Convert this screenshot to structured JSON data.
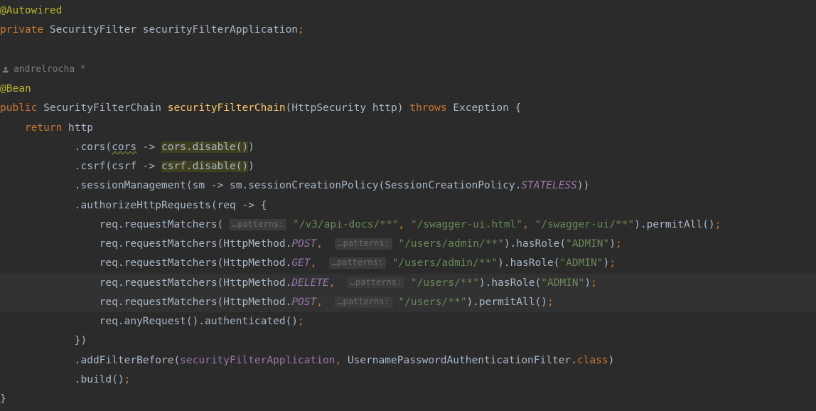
{
  "author": {
    "name": "andrelrocha *"
  },
  "l1": {
    "anno": "@Autowired"
  },
  "l2": {
    "kw": "private ",
    "type": "SecurityFilter ",
    "field": "securityFilterApplication",
    "semi": ";"
  },
  "l4": {
    "anno": "@Bean"
  },
  "l5": {
    "kw1": "public ",
    "type1": "SecurityFilterChain ",
    "mname": "securityFilterChain",
    "open": "(",
    "ptype": "HttpSecurity ",
    "pname": "http",
    "close": ") ",
    "kw2": "throws ",
    "exc": "Exception ",
    "brace": "{"
  },
  "l6": {
    "kw": "return ",
    "expr": "http"
  },
  "l7": {
    "pre": ".cors(",
    "p": "cors",
    "arrow": " -> ",
    "warn": "cors.disable()",
    "post": ")"
  },
  "l8": {
    "pre": ".csrf(csrf -> ",
    "warn": "csrf.disable()",
    "post": ")"
  },
  "l9": {
    "pre": ".sessionManagement(sm -> sm.sessionCreationPolicy(SessionCreationPolicy.",
    "const": "STATELESS",
    "post": "))"
  },
  "l10": {
    "txt": ".authorizeHttpRequests(req -> {"
  },
  "hint": "…patterns:",
  "l11": {
    "a": "req.requestMatchers( ",
    "s1": "\"/v3/api-docs/**\"",
    "c1": ", ",
    "s2": "\"/swagger-ui.html\"",
    "c2": ", ",
    "s3": "\"/swagger-ui/**\"",
    "tail": ").permitAll()",
    "semi": ";"
  },
  "l12": {
    "a": "req.requestMatchers(HttpMethod.",
    "m": "POST",
    "c": ", ",
    "s": "\"/users/admin/**\"",
    "tail": ").hasRole(",
    "role": "\"ADMIN\"",
    "close": ")",
    "semi": ";"
  },
  "l13": {
    "a": "req.requestMatchers(HttpMethod.",
    "m": "GET",
    "c": ", ",
    "s": "\"/users/admin/**\"",
    "tail": ").hasRole(",
    "role": "\"ADMIN\"",
    "close": ")",
    "semi": ";"
  },
  "l14": {
    "a": "req.requestMatchers(HttpMethod.",
    "m": "DELETE",
    "c": ", ",
    "s": "\"/users/**\"",
    "tail": ").hasRole(",
    "role": "\"ADMIN\"",
    "close": ")",
    "semi": ";"
  },
  "l15": {
    "a": "req.requestMatchers(HttpMethod.",
    "m": "POST",
    "c": ", ",
    "s": "\"/users/**\"",
    "tail": ").permitAll()",
    "semi": ";"
  },
  "l16": {
    "a": "req.anyRequest().authenticated()",
    "semi": ";"
  },
  "l17": {
    "txt": "})"
  },
  "l18": {
    "a": ".addFilterBefore(",
    "f": "securityFilterApplication",
    "c": ", ",
    "cls": "UsernamePasswordAuthenticationFilter.",
    "kw": "class",
    "close": ")"
  },
  "l19": {
    "a": ".build()",
    "semi": ";"
  },
  "l20": {
    "brace": "}"
  }
}
